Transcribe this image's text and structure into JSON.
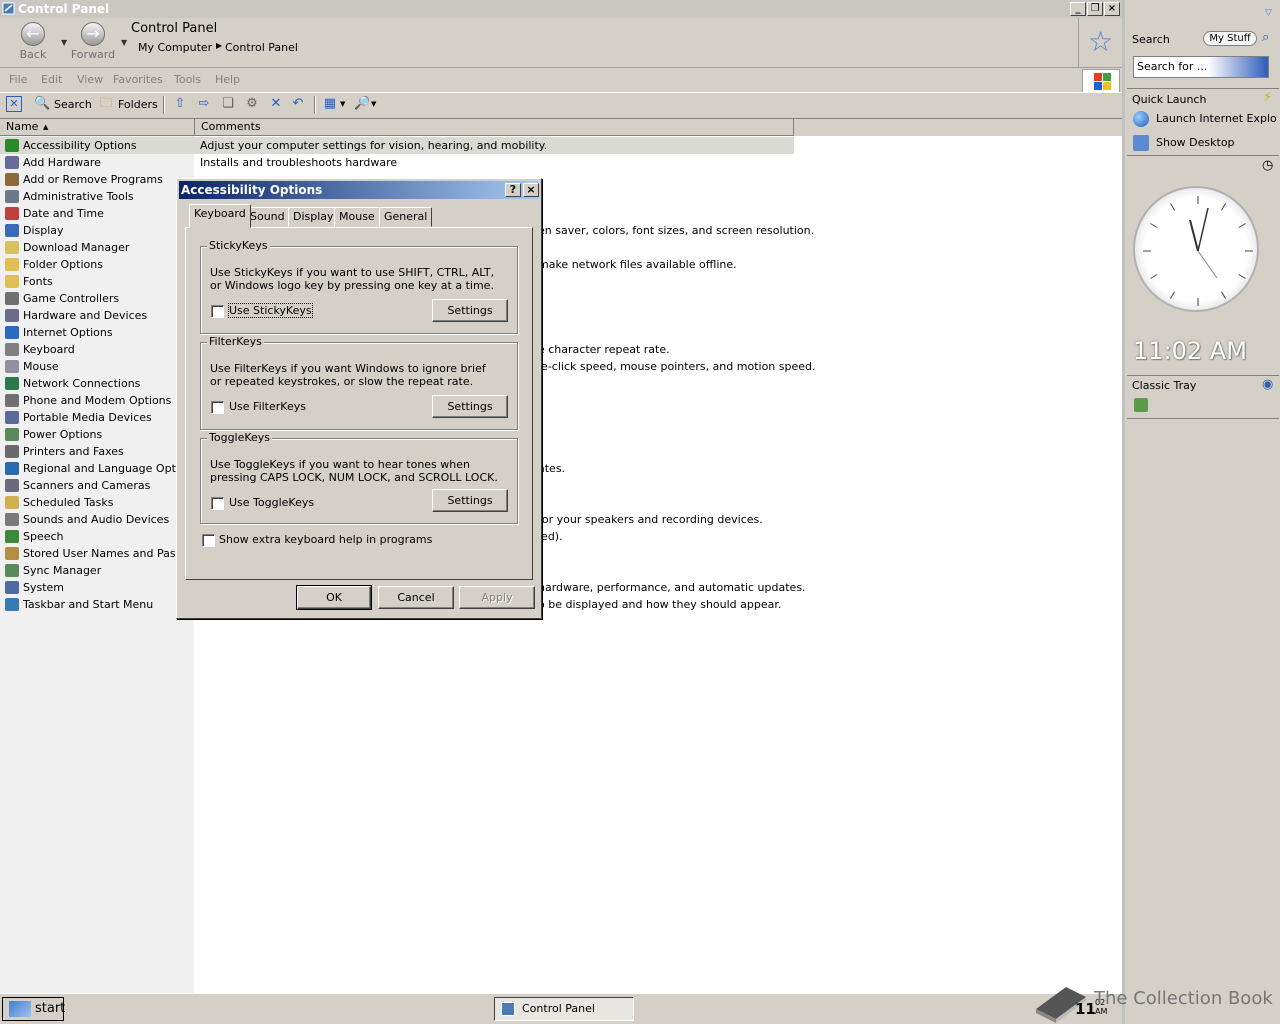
{
  "window": {
    "title": "Control Panel"
  },
  "nav": {
    "back": "Back",
    "forward": "Forward",
    "title": "Control Panel",
    "crumb1": "My Computer",
    "crumb2": "Control Panel"
  },
  "menu": {
    "file": "File",
    "edit": "Edit",
    "view": "View",
    "favorites": "Favorites",
    "tools": "Tools",
    "help": "Help"
  },
  "toolbar": {
    "search": "Search",
    "folders": "Folders"
  },
  "list": {
    "col_name": "Name",
    "col_comments": "Comments",
    "items": [
      {
        "name": "Accessibility Options",
        "comment": "Adjust your computer settings for vision, hearing, and mobility.",
        "color": "#2a8a2a"
      },
      {
        "name": "Add Hardware",
        "comment": "Installs and troubleshoots hardware",
        "color": "#6a6a9a"
      },
      {
        "name": "Add or Remove Programs",
        "comment": "",
        "color": "#8a6a3a"
      },
      {
        "name": "Administrative Tools",
        "comment": "",
        "color": "#6a7a8a"
      },
      {
        "name": "Date and Time",
        "comment": "",
        "color": "#c04040"
      },
      {
        "name": "Display",
        "comment": "en saver, colors, font sizes, and screen resolution.",
        "color": "#3a6ab8"
      },
      {
        "name": "Download Manager",
        "comment": "",
        "color": "#d8c060"
      },
      {
        "name": "Folder Options",
        "comment": "make network files available offline.",
        "color": "#e0c050"
      },
      {
        "name": "Fonts",
        "comment": "",
        "color": "#e0c050"
      },
      {
        "name": "Game Controllers",
        "comment": "",
        "color": "#707070"
      },
      {
        "name": "Hardware and Devices",
        "comment": "",
        "color": "#6a6a8a"
      },
      {
        "name": "Internet Options",
        "comment": "",
        "color": "#2a6ac0"
      },
      {
        "name": "Keyboard",
        "comment": "e character repeat rate.",
        "color": "#808080"
      },
      {
        "name": "Mouse",
        "comment": "le-click speed, mouse pointers, and motion speed.",
        "color": "#9090a0"
      },
      {
        "name": "Network Connections",
        "comment": "",
        "color": "#2a7a4a"
      },
      {
        "name": "Phone and Modem Options",
        "comment": "",
        "color": "#707070"
      },
      {
        "name": "Portable Media Devices",
        "comment": "",
        "color": "#5a6a9a"
      },
      {
        "name": "Power Options",
        "comment": "",
        "color": "#5a8a5a"
      },
      {
        "name": "Printers and Faxes",
        "comment": "",
        "color": "#6a6a6a"
      },
      {
        "name": "Regional and Language Options",
        "comment": "ates.",
        "color": "#2a6ab0"
      },
      {
        "name": "Scanners and Cameras",
        "comment": "",
        "color": "#6a6a7a"
      },
      {
        "name": "Scheduled Tasks",
        "comment": "",
        "color": "#d0b050"
      },
      {
        "name": "Sounds and Audio Devices",
        "comment": "for your speakers and recording devices.",
        "color": "#7a7a7a"
      },
      {
        "name": "Speech",
        "comment": "led).",
        "color": "#3a8a3a"
      },
      {
        "name": "Stored User Names and Passwo",
        "comment": "",
        "color": "#b09040"
      },
      {
        "name": "Sync Manager",
        "comment": "",
        "color": "#5a8a5a"
      },
      {
        "name": "System",
        "comment": "hardware, performance, and automatic updates.",
        "color": "#4a6aa0"
      },
      {
        "name": "Taskbar and Start Menu",
        "comment": "o be displayed and how they should appear.",
        "color": "#3a7ab0"
      }
    ]
  },
  "dialog": {
    "title": "Accessibility Options",
    "help_btn": "?",
    "close_btn": "×",
    "tabs": [
      "Keyboard",
      "Sound",
      "Display",
      "Mouse",
      "General"
    ],
    "stickykeys": {
      "legend": "StickyKeys",
      "desc": "Use StickyKeys if you want to use SHIFT, CTRL, ALT, or Windows logo key by pressing one key at a time.",
      "check": "Use StickyKeys",
      "settings": "Settings"
    },
    "filterkeys": {
      "legend": "FilterKeys",
      "desc": "Use FilterKeys if you want Windows to ignore brief or repeated keystrokes, or slow the repeat rate.",
      "check": "Use FilterKeys",
      "settings": "Settings"
    },
    "togglekeys": {
      "legend": "ToggleKeys",
      "desc": "Use ToggleKeys if you want to hear tones when pressing CAPS LOCK, NUM LOCK, and SCROLL LOCK.",
      "check": "Use ToggleKeys",
      "settings": "Settings"
    },
    "extra_help": "Show extra keyboard help in programs",
    "ok": "OK",
    "cancel": "Cancel",
    "apply": "Apply"
  },
  "sidebar": {
    "search_title": "Search",
    "my_stuff": "My Stuff",
    "search_placeholder": "Search for ...",
    "quick_launch": "Quick Launch",
    "ql_items": [
      "Launch Internet Explore",
      "Show Desktop"
    ],
    "clock_time": "11:02 AM",
    "classic_tray": "Classic Tray"
  },
  "taskbar": {
    "start": "start",
    "task": "Control Panel",
    "time_big": "11",
    "time_small": "02",
    "time_ampm": "AM"
  },
  "watermark": "The Collection Book"
}
